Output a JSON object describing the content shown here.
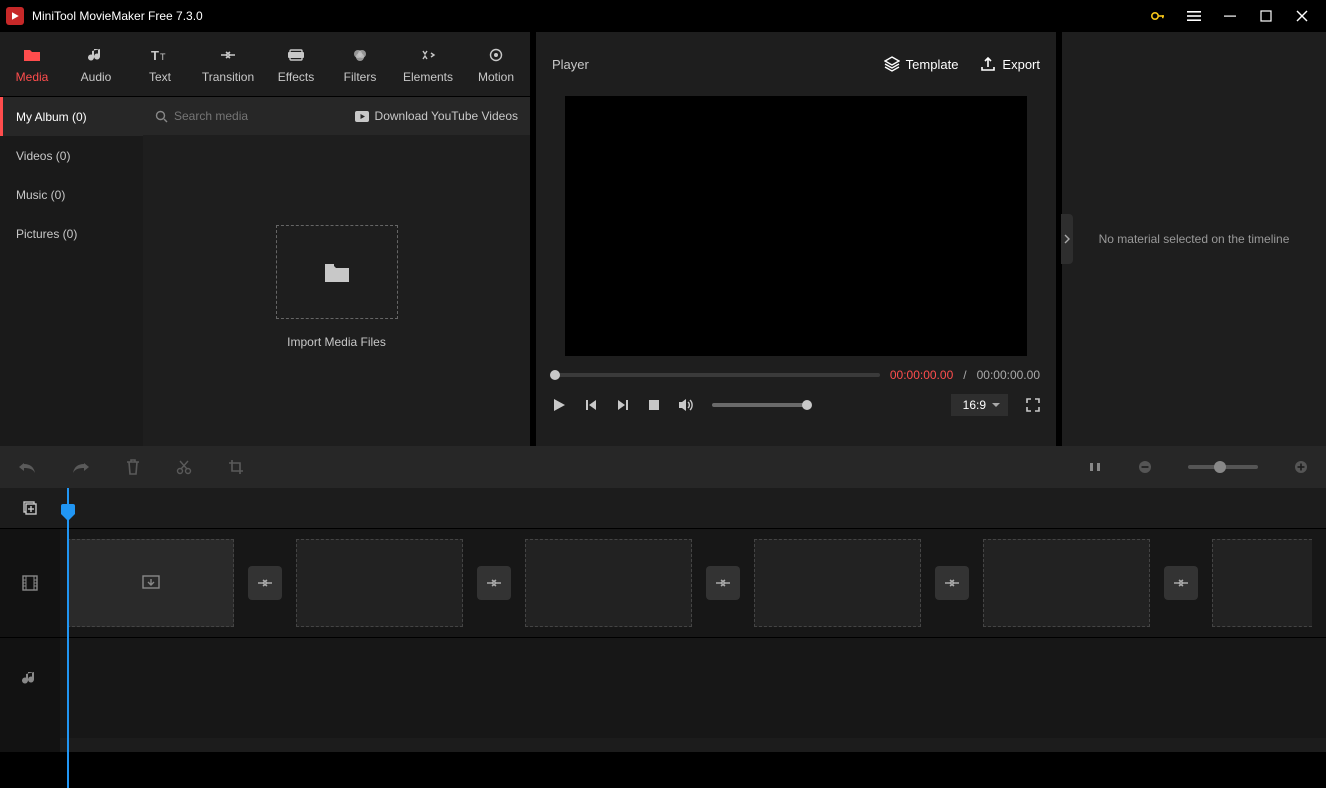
{
  "app": {
    "title": "MiniTool MovieMaker Free 7.3.0"
  },
  "tabs": {
    "media": "Media",
    "audio": "Audio",
    "text": "Text",
    "transition": "Transition",
    "effects": "Effects",
    "filters": "Filters",
    "elements": "Elements",
    "motion": "Motion"
  },
  "media_sidebar": {
    "album": "My Album (0)",
    "videos": "Videos (0)",
    "music": "Music (0)",
    "pictures": "Pictures (0)"
  },
  "media_panel": {
    "search_placeholder": "Search media",
    "download_link": "Download YouTube Videos",
    "import_label": "Import Media Files"
  },
  "player": {
    "title": "Player",
    "template_btn": "Template",
    "export_btn": "Export",
    "time_current": "00:00:00.00",
    "time_sep": "/",
    "time_total": "00:00:00.00",
    "ratio": "16:9"
  },
  "inspector": {
    "message": "No material selected on the timeline"
  }
}
